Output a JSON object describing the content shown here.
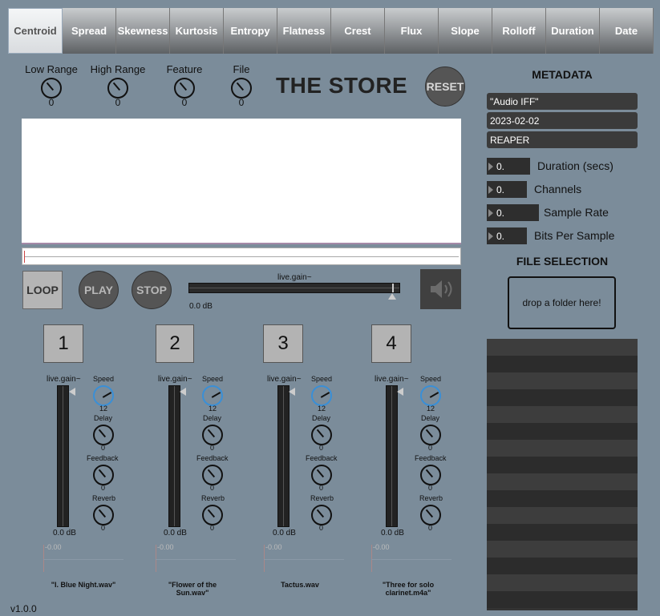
{
  "tabs": [
    "Centroid",
    "Spread",
    "Skewness",
    "Kurtosis",
    "Entropy",
    "Flatness",
    "Crest",
    "Flux",
    "Slope",
    "Rolloff",
    "Duration",
    "Date"
  ],
  "active_tab": "Centroid",
  "knobs": [
    {
      "label": "Low Range",
      "value": "0"
    },
    {
      "label": "High Range",
      "value": "0"
    },
    {
      "label": "Feature",
      "value": "0"
    },
    {
      "label": "File",
      "value": "0"
    }
  ],
  "title": "THE STORE",
  "reset_label": "RESET",
  "transport": {
    "loop": "LOOP",
    "play": "PLAY",
    "stop": "STOP"
  },
  "master_gain": {
    "label": "live.gain~",
    "value": "0.0 dB"
  },
  "channels": [
    {
      "num": "1",
      "gain_label": "live.gain~",
      "gain_value": "0.0 dB",
      "speed_label": "Speed",
      "speed": "12",
      "delay_label": "Delay",
      "delay": "0",
      "feedback_label": "Feedback",
      "feedback": "0",
      "reverb_label": "Reverb",
      "reverb": "0",
      "scope": "-0.00",
      "file": "\"I. Blue Night.wav\""
    },
    {
      "num": "2",
      "gain_label": "live.gain~",
      "gain_value": "0.0 dB",
      "speed_label": "Speed",
      "speed": "12",
      "delay_label": "Delay",
      "delay": "0",
      "feedback_label": "Feedback",
      "feedback": "0",
      "reverb_label": "Reverb",
      "reverb": "0",
      "scope": "-0.00",
      "file": "\"Flower of the Sun.wav\""
    },
    {
      "num": "3",
      "gain_label": "live.gain~",
      "gain_value": "0.0 dB",
      "speed_label": "Speed",
      "speed": "12",
      "delay_label": "Delay",
      "delay": "0",
      "feedback_label": "Feedback",
      "feedback": "0",
      "reverb_label": "Reverb",
      "reverb": "0",
      "scope": "-0.00",
      "file": "Tactus.wav"
    },
    {
      "num": "4",
      "gain_label": "live.gain~",
      "gain_value": "0.0 dB",
      "speed_label": "Speed",
      "speed": "12",
      "delay_label": "Delay",
      "delay": "0",
      "feedback_label": "Feedback",
      "feedback": "0",
      "reverb_label": "Reverb",
      "reverb": "0",
      "scope": "-0.00",
      "file": "\"Three for solo clarinet.m4a\""
    }
  ],
  "metadata": {
    "header": "METADATA",
    "fields": [
      "\"Audio IFF\"",
      "2023-02-02",
      "REAPER"
    ],
    "numbers": [
      {
        "value": "0.",
        "label": "Duration (secs)"
      },
      {
        "value": "0.",
        "label": "Channels"
      },
      {
        "value": "0.",
        "label": "Sample Rate"
      },
      {
        "value": "0.",
        "label": "Bits Per Sample"
      }
    ]
  },
  "file_selection": {
    "header": "FILE SELECTION",
    "drop_text": "drop a folder here!"
  },
  "version": "v1.0.0"
}
